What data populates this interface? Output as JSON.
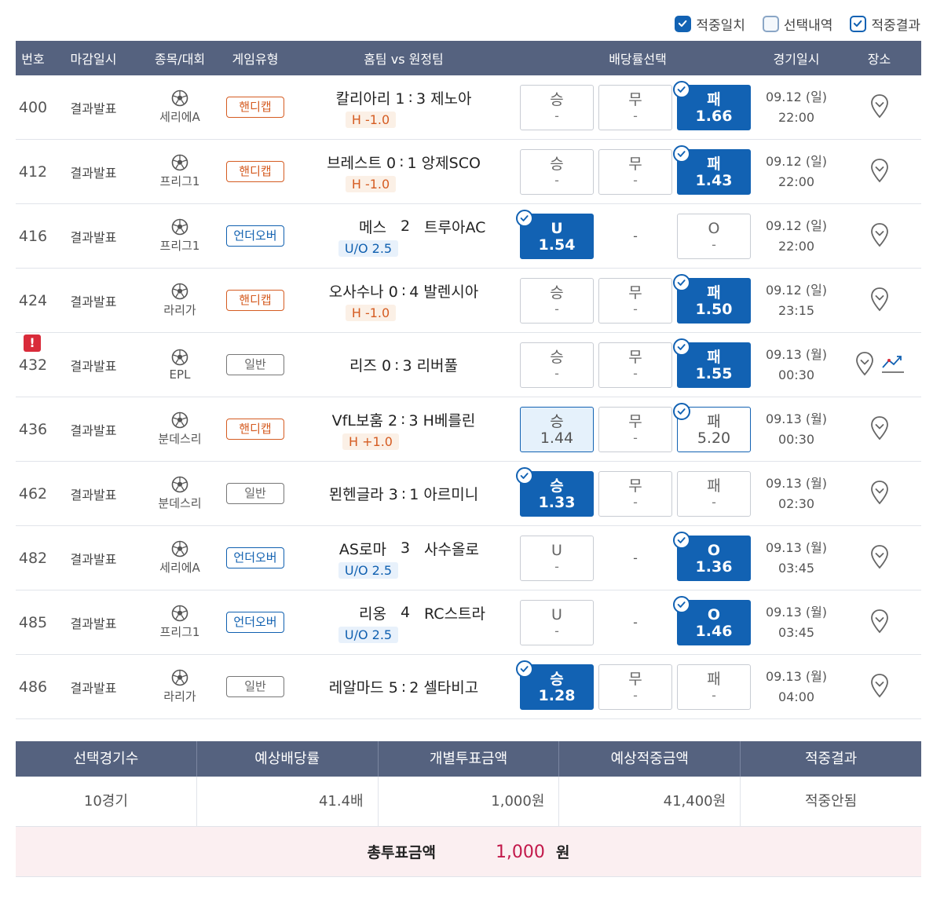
{
  "filters": [
    {
      "label": "적중일치",
      "state": "filled"
    },
    {
      "label": "선택내역",
      "state": "empty"
    },
    {
      "label": "적중결과",
      "state": "outline"
    }
  ],
  "columns": [
    "번호",
    "마감일시",
    "종목/대회",
    "게임유형",
    "홈팀 vs 원정팀",
    "배당률선택",
    "경기일시",
    "장소"
  ],
  "rows": [
    {
      "no": "400",
      "deadline": "결과발표",
      "league": "세리에A",
      "type": "핸디캡",
      "type_kind": "hd",
      "home": "칼리아리 1",
      "score": ":",
      "away": "3 제노아",
      "sub": "H -1.0",
      "warn": false,
      "chart": false,
      "odds": [
        {
          "label": "승",
          "value": "-",
          "state": "normal",
          "check": false
        },
        {
          "label": "무",
          "value": "-",
          "state": "normal",
          "check": false
        },
        {
          "label": "패",
          "value": "1.66",
          "state": "hit",
          "check": true
        }
      ],
      "date": "09.12 (일)",
      "time": "22:00"
    },
    {
      "no": "412",
      "deadline": "결과발표",
      "league": "프리그1",
      "type": "핸디캡",
      "type_kind": "hd",
      "home": "브레스트 0",
      "score": ":",
      "away": "1 앙제SCO",
      "sub": "H -1.0",
      "warn": false,
      "chart": false,
      "odds": [
        {
          "label": "승",
          "value": "-",
          "state": "normal",
          "check": false
        },
        {
          "label": "무",
          "value": "-",
          "state": "normal",
          "check": false
        },
        {
          "label": "패",
          "value": "1.43",
          "state": "hit",
          "check": true
        }
      ],
      "date": "09.12 (일)",
      "time": "22:00"
    },
    {
      "no": "416",
      "deadline": "결과발표",
      "league": "프리그1",
      "type": "언더오버",
      "type_kind": "uo",
      "home": "메스",
      "score": "2",
      "away": "트루아AC",
      "sub": "U/O 2.5",
      "warn": false,
      "chart": false,
      "odds": [
        {
          "label": "U",
          "value": "1.54",
          "state": "hit",
          "check": true
        },
        {
          "label": "-",
          "value": "",
          "state": "dash",
          "check": false
        },
        {
          "label": "O",
          "value": "-",
          "state": "normal",
          "check": false
        }
      ],
      "date": "09.12 (일)",
      "time": "22:00"
    },
    {
      "no": "424",
      "deadline": "결과발표",
      "league": "라리가",
      "type": "핸디캡",
      "type_kind": "hd",
      "home": "오사수나 0",
      "score": ":",
      "away": "4 발렌시아",
      "sub": "H -1.0",
      "warn": false,
      "chart": false,
      "odds": [
        {
          "label": "승",
          "value": "-",
          "state": "normal",
          "check": false
        },
        {
          "label": "무",
          "value": "-",
          "state": "normal",
          "check": false
        },
        {
          "label": "패",
          "value": "1.50",
          "state": "hit",
          "check": true
        }
      ],
      "date": "09.12 (일)",
      "time": "23:15"
    },
    {
      "no": "432",
      "deadline": "결과발표",
      "league": "EPL",
      "type": "일반",
      "type_kind": "gen",
      "home": "리즈 0",
      "score": ":",
      "away": "3 리버풀",
      "sub": "",
      "warn": true,
      "chart": true,
      "odds": [
        {
          "label": "승",
          "value": "-",
          "state": "normal",
          "check": false
        },
        {
          "label": "무",
          "value": "-",
          "state": "normal",
          "check": false
        },
        {
          "label": "패",
          "value": "1.55",
          "state": "hit",
          "check": true
        }
      ],
      "date": "09.13 (월)",
      "time": "00:30"
    },
    {
      "no": "436",
      "deadline": "결과발표",
      "league": "분데스리",
      "type": "핸디캡",
      "type_kind": "hd",
      "home": "VfL보훔 2",
      "score": ":",
      "away": "3 H베를린",
      "sub": "H +1.0",
      "warn": false,
      "chart": false,
      "odds": [
        {
          "label": "승",
          "value": "1.44",
          "state": "sel",
          "check": false
        },
        {
          "label": "무",
          "value": "-",
          "state": "normal",
          "check": false
        },
        {
          "label": "패",
          "value": "5.20",
          "state": "res",
          "check": true
        }
      ],
      "date": "09.13 (월)",
      "time": "00:30"
    },
    {
      "no": "462",
      "deadline": "결과발표",
      "league": "분데스리",
      "type": "일반",
      "type_kind": "gen",
      "home": "묀헨글라 3",
      "score": ":",
      "away": "1 아르미니",
      "sub": "",
      "warn": false,
      "chart": false,
      "odds": [
        {
          "label": "승",
          "value": "1.33",
          "state": "hit",
          "check": true
        },
        {
          "label": "무",
          "value": "-",
          "state": "normal",
          "check": false
        },
        {
          "label": "패",
          "value": "-",
          "state": "normal",
          "check": false
        }
      ],
      "date": "09.13 (월)",
      "time": "02:30"
    },
    {
      "no": "482",
      "deadline": "결과발표",
      "league": "세리에A",
      "type": "언더오버",
      "type_kind": "uo",
      "home": "AS로마",
      "score": "3",
      "away": "사수올로",
      "sub": "U/O 2.5",
      "warn": false,
      "chart": false,
      "odds": [
        {
          "label": "U",
          "value": "-",
          "state": "normal",
          "check": false
        },
        {
          "label": "-",
          "value": "",
          "state": "dash",
          "check": false
        },
        {
          "label": "O",
          "value": "1.36",
          "state": "hit",
          "check": true
        }
      ],
      "date": "09.13 (월)",
      "time": "03:45"
    },
    {
      "no": "485",
      "deadline": "결과발표",
      "league": "프리그1",
      "type": "언더오버",
      "type_kind": "uo",
      "home": "리옹",
      "score": "4",
      "away": "RC스트라",
      "sub": "U/O 2.5",
      "warn": false,
      "chart": false,
      "odds": [
        {
          "label": "U",
          "value": "-",
          "state": "normal",
          "check": false
        },
        {
          "label": "-",
          "value": "",
          "state": "dash",
          "check": false
        },
        {
          "label": "O",
          "value": "1.46",
          "state": "hit",
          "check": true
        }
      ],
      "date": "09.13 (월)",
      "time": "03:45"
    },
    {
      "no": "486",
      "deadline": "결과발표",
      "league": "라리가",
      "type": "일반",
      "type_kind": "gen",
      "home": "레알마드 5",
      "score": ":",
      "away": "2 셀타비고",
      "sub": "",
      "warn": false,
      "chart": false,
      "odds": [
        {
          "label": "승",
          "value": "1.28",
          "state": "hit",
          "check": true
        },
        {
          "label": "무",
          "value": "-",
          "state": "normal",
          "check": false
        },
        {
          "label": "패",
          "value": "-",
          "state": "normal",
          "check": false
        }
      ],
      "date": "09.13 (월)",
      "time": "04:00"
    }
  ],
  "summary": {
    "headers": [
      "선택경기수",
      "예상배당률",
      "개별투표금액",
      "예상적중금액",
      "적중결과"
    ],
    "values": [
      "10경기",
      "41.4배",
      "1,000원",
      "41,400원",
      "적중안됨"
    ]
  },
  "total": {
    "label": "총투표금액",
    "value": "1,000",
    "unit": "원"
  },
  "colors": {
    "header": "#55627f",
    "accent": "#1262b3",
    "handicap": "#d55c22",
    "total_value": "#c2184a"
  },
  "icons": {
    "sport": "soccer-ball-icon",
    "place": "map-pin-icon",
    "chart": "trend-chart-icon",
    "check": "check-icon",
    "warn": "alert-icon"
  }
}
